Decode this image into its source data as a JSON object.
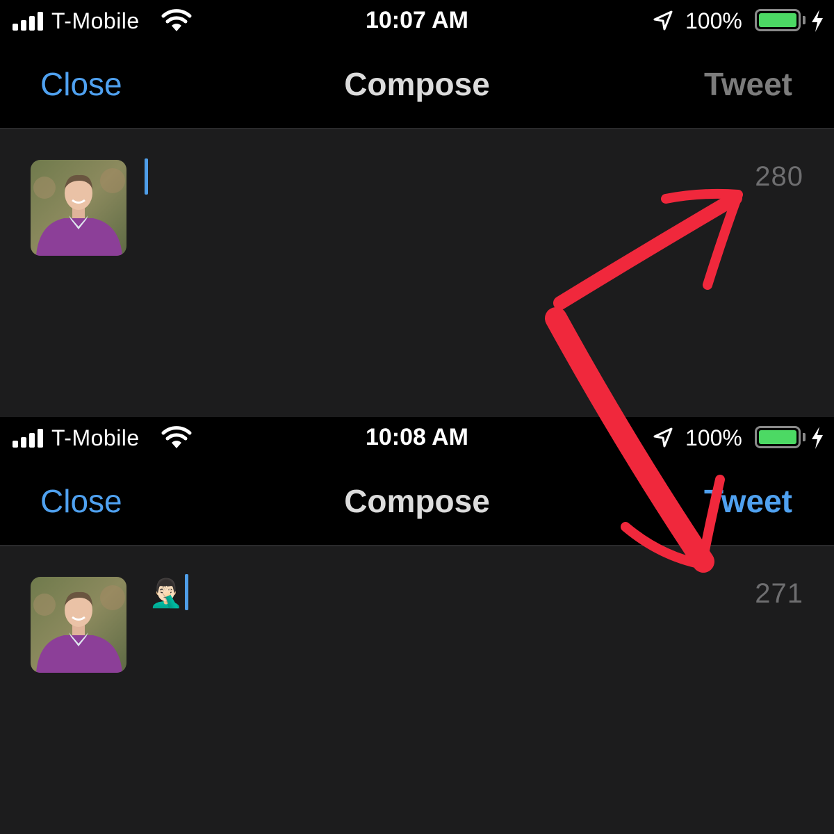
{
  "panels": [
    {
      "status": {
        "carrier": "T-Mobile",
        "time": "10:07 AM",
        "battery": "100%"
      },
      "nav": {
        "close": "Close",
        "title": "Compose",
        "tweet": "Tweet",
        "tweet_enabled": false
      },
      "compose": {
        "text": "",
        "char_count": "280"
      }
    },
    {
      "status": {
        "carrier": "T-Mobile",
        "time": "10:08 AM",
        "battery": "100%"
      },
      "nav": {
        "close": "Close",
        "title": "Compose",
        "tweet": "Tweet",
        "tweet_enabled": true
      },
      "compose": {
        "text": "🤦🏻‍♂️",
        "char_count": "271"
      }
    }
  ],
  "colors": {
    "accent_blue": "#4fa1f0",
    "annotation_red": "#f0283c",
    "battery_green": "#4cd964",
    "counter_gray": "#6e6e70",
    "background": "#1c1c1d"
  },
  "icons": [
    "signal-icon",
    "wifi-icon",
    "location-arrow-icon",
    "battery-icon",
    "charging-bolt-icon"
  ]
}
